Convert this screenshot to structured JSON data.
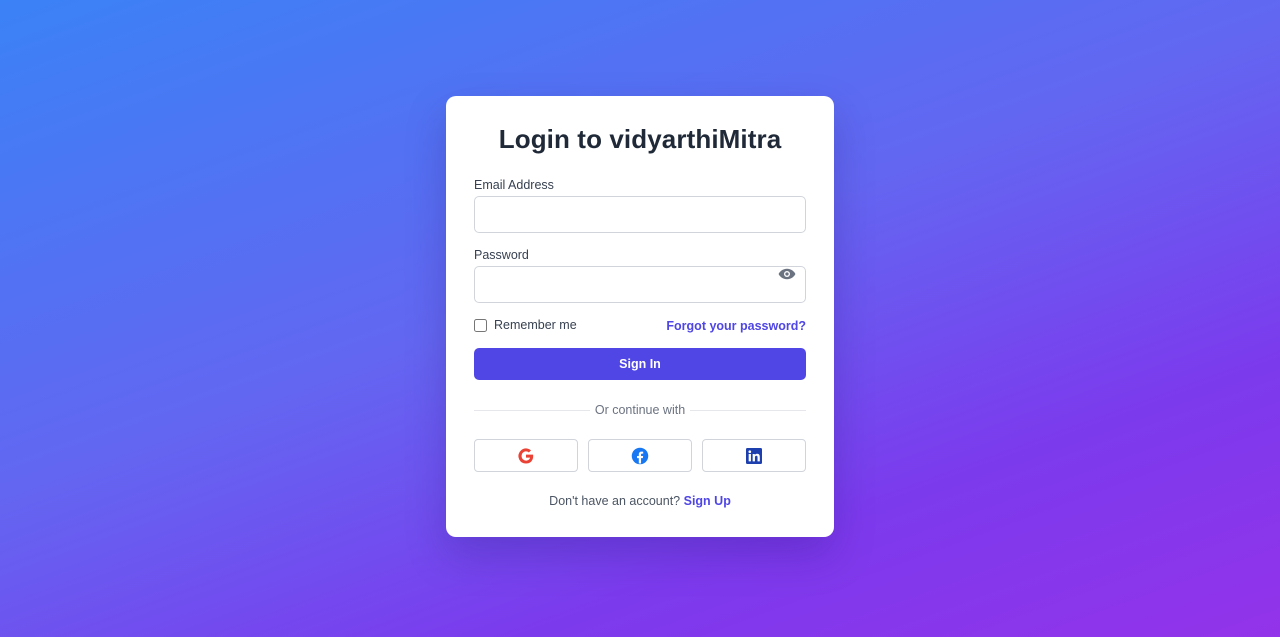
{
  "login": {
    "title": "Login to vidyarthiMitra",
    "email_label": "Email Address",
    "email_value": "",
    "password_label": "Password",
    "password_value": "",
    "remember_label": "Remember me",
    "forgot_label": "Forgot your password?",
    "signin_label": "Sign In",
    "divider_text": "Or continue with",
    "socials": [
      {
        "icon": "google-icon"
      },
      {
        "icon": "facebook-icon"
      },
      {
        "icon": "linkedin-icon"
      }
    ],
    "footer_text": "Don't have an account?",
    "signup_label": "Sign Up"
  },
  "colors": {
    "accent": "#4f46e5",
    "google": "#ea4335",
    "facebook": "#1877f2",
    "linkedin": "#1e40af"
  }
}
